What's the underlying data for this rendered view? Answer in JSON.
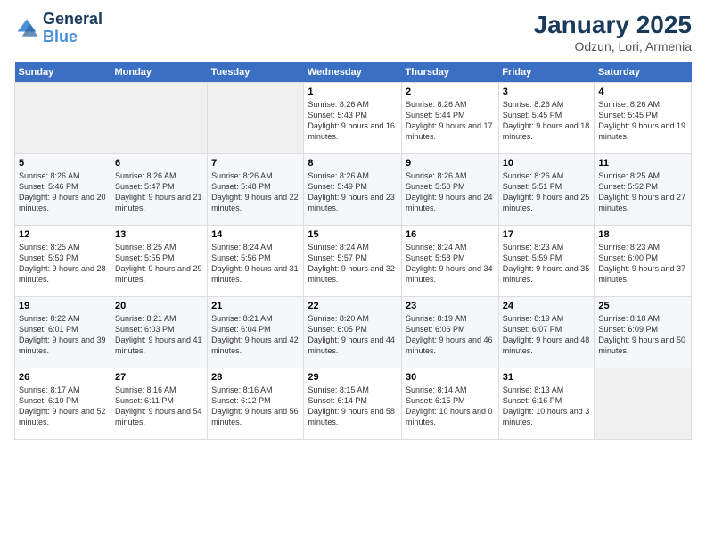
{
  "logo": {
    "line1": "General",
    "line2": "Blue"
  },
  "title": "January 2025",
  "subtitle": "Odzun, Lori, Armenia",
  "days_header": [
    "Sunday",
    "Monday",
    "Tuesday",
    "Wednesday",
    "Thursday",
    "Friday",
    "Saturday"
  ],
  "weeks": [
    [
      {
        "num": "",
        "info": ""
      },
      {
        "num": "",
        "info": ""
      },
      {
        "num": "",
        "info": ""
      },
      {
        "num": "1",
        "info": "Sunrise: 8:26 AM\nSunset: 5:43 PM\nDaylight: 9 hours and 16 minutes."
      },
      {
        "num": "2",
        "info": "Sunrise: 8:26 AM\nSunset: 5:44 PM\nDaylight: 9 hours and 17 minutes."
      },
      {
        "num": "3",
        "info": "Sunrise: 8:26 AM\nSunset: 5:45 PM\nDaylight: 9 hours and 18 minutes."
      },
      {
        "num": "4",
        "info": "Sunrise: 8:26 AM\nSunset: 5:45 PM\nDaylight: 9 hours and 19 minutes."
      }
    ],
    [
      {
        "num": "5",
        "info": "Sunrise: 8:26 AM\nSunset: 5:46 PM\nDaylight: 9 hours and 20 minutes."
      },
      {
        "num": "6",
        "info": "Sunrise: 8:26 AM\nSunset: 5:47 PM\nDaylight: 9 hours and 21 minutes."
      },
      {
        "num": "7",
        "info": "Sunrise: 8:26 AM\nSunset: 5:48 PM\nDaylight: 9 hours and 22 minutes."
      },
      {
        "num": "8",
        "info": "Sunrise: 8:26 AM\nSunset: 5:49 PM\nDaylight: 9 hours and 23 minutes."
      },
      {
        "num": "9",
        "info": "Sunrise: 8:26 AM\nSunset: 5:50 PM\nDaylight: 9 hours and 24 minutes."
      },
      {
        "num": "10",
        "info": "Sunrise: 8:26 AM\nSunset: 5:51 PM\nDaylight: 9 hours and 25 minutes."
      },
      {
        "num": "11",
        "info": "Sunrise: 8:25 AM\nSunset: 5:52 PM\nDaylight: 9 hours and 27 minutes."
      }
    ],
    [
      {
        "num": "12",
        "info": "Sunrise: 8:25 AM\nSunset: 5:53 PM\nDaylight: 9 hours and 28 minutes."
      },
      {
        "num": "13",
        "info": "Sunrise: 8:25 AM\nSunset: 5:55 PM\nDaylight: 9 hours and 29 minutes."
      },
      {
        "num": "14",
        "info": "Sunrise: 8:24 AM\nSunset: 5:56 PM\nDaylight: 9 hours and 31 minutes."
      },
      {
        "num": "15",
        "info": "Sunrise: 8:24 AM\nSunset: 5:57 PM\nDaylight: 9 hours and 32 minutes."
      },
      {
        "num": "16",
        "info": "Sunrise: 8:24 AM\nSunset: 5:58 PM\nDaylight: 9 hours and 34 minutes."
      },
      {
        "num": "17",
        "info": "Sunrise: 8:23 AM\nSunset: 5:59 PM\nDaylight: 9 hours and 35 minutes."
      },
      {
        "num": "18",
        "info": "Sunrise: 8:23 AM\nSunset: 6:00 PM\nDaylight: 9 hours and 37 minutes."
      }
    ],
    [
      {
        "num": "19",
        "info": "Sunrise: 8:22 AM\nSunset: 6:01 PM\nDaylight: 9 hours and 39 minutes."
      },
      {
        "num": "20",
        "info": "Sunrise: 8:21 AM\nSunset: 6:03 PM\nDaylight: 9 hours and 41 minutes."
      },
      {
        "num": "21",
        "info": "Sunrise: 8:21 AM\nSunset: 6:04 PM\nDaylight: 9 hours and 42 minutes."
      },
      {
        "num": "22",
        "info": "Sunrise: 8:20 AM\nSunset: 6:05 PM\nDaylight: 9 hours and 44 minutes."
      },
      {
        "num": "23",
        "info": "Sunrise: 8:19 AM\nSunset: 6:06 PM\nDaylight: 9 hours and 46 minutes."
      },
      {
        "num": "24",
        "info": "Sunrise: 8:19 AM\nSunset: 6:07 PM\nDaylight: 9 hours and 48 minutes."
      },
      {
        "num": "25",
        "info": "Sunrise: 8:18 AM\nSunset: 6:09 PM\nDaylight: 9 hours and 50 minutes."
      }
    ],
    [
      {
        "num": "26",
        "info": "Sunrise: 8:17 AM\nSunset: 6:10 PM\nDaylight: 9 hours and 52 minutes."
      },
      {
        "num": "27",
        "info": "Sunrise: 8:16 AM\nSunset: 6:11 PM\nDaylight: 9 hours and 54 minutes."
      },
      {
        "num": "28",
        "info": "Sunrise: 8:16 AM\nSunset: 6:12 PM\nDaylight: 9 hours and 56 minutes."
      },
      {
        "num": "29",
        "info": "Sunrise: 8:15 AM\nSunset: 6:14 PM\nDaylight: 9 hours and 58 minutes."
      },
      {
        "num": "30",
        "info": "Sunrise: 8:14 AM\nSunset: 6:15 PM\nDaylight: 10 hours and 0 minutes."
      },
      {
        "num": "31",
        "info": "Sunrise: 8:13 AM\nSunset: 6:16 PM\nDaylight: 10 hours and 3 minutes."
      },
      {
        "num": "",
        "info": ""
      }
    ]
  ]
}
